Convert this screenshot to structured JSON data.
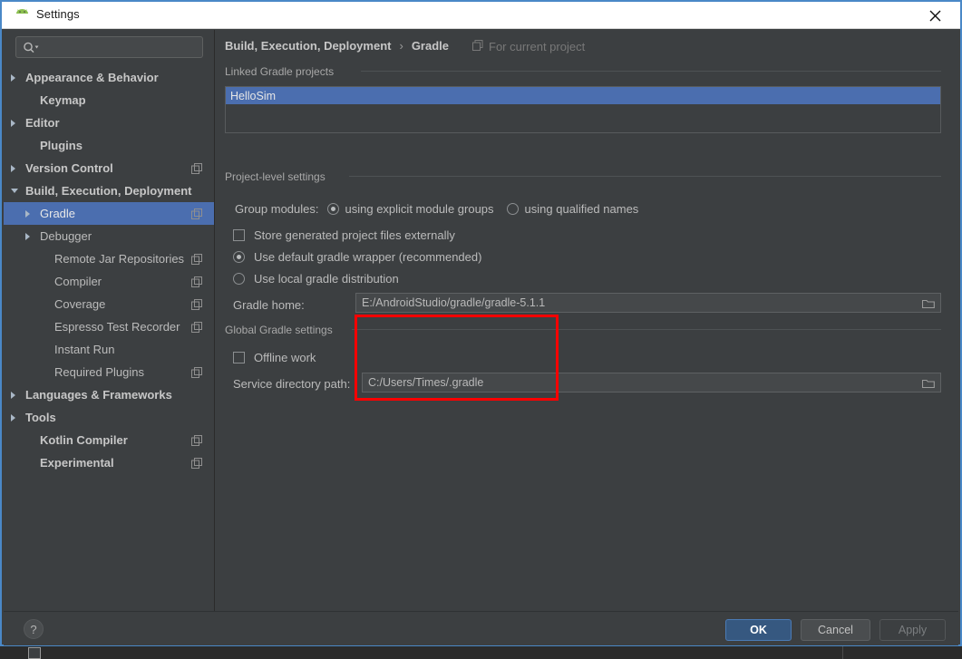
{
  "window": {
    "title": "Settings",
    "app_icon": "android-icon",
    "close_icon": "close-icon"
  },
  "sidebar": {
    "search": {
      "placeholder": "",
      "value": "",
      "icon": "search-icon"
    },
    "items": [
      {
        "label": "Appearance & Behavior",
        "arrow": "collapsed",
        "indent": 24,
        "bold": true,
        "copy": false,
        "selected": false
      },
      {
        "label": "Keymap",
        "arrow": "none",
        "indent": 40,
        "bold": true,
        "copy": false,
        "selected": false
      },
      {
        "label": "Editor",
        "arrow": "collapsed",
        "indent": 24,
        "bold": true,
        "copy": false,
        "selected": false
      },
      {
        "label": "Plugins",
        "arrow": "none",
        "indent": 40,
        "bold": true,
        "copy": false,
        "selected": false
      },
      {
        "label": "Version Control",
        "arrow": "collapsed",
        "indent": 24,
        "bold": true,
        "copy": true,
        "selected": false
      },
      {
        "label": "Build, Execution, Deployment",
        "arrow": "open",
        "indent": 24,
        "bold": true,
        "copy": false,
        "selected": false
      },
      {
        "label": "Gradle",
        "arrow": "collapsed",
        "indent": 40,
        "bold": false,
        "copy": true,
        "selected": true
      },
      {
        "label": "Debugger",
        "arrow": "collapsed",
        "indent": 40,
        "bold": false,
        "copy": false,
        "selected": false
      },
      {
        "label": "Remote Jar Repositories",
        "arrow": "none",
        "indent": 56,
        "bold": false,
        "copy": true,
        "selected": false
      },
      {
        "label": "Compiler",
        "arrow": "none",
        "indent": 56,
        "bold": false,
        "copy": true,
        "selected": false
      },
      {
        "label": "Coverage",
        "arrow": "none",
        "indent": 56,
        "bold": false,
        "copy": true,
        "selected": false
      },
      {
        "label": "Espresso Test Recorder",
        "arrow": "none",
        "indent": 56,
        "bold": false,
        "copy": true,
        "selected": false
      },
      {
        "label": "Instant Run",
        "arrow": "none",
        "indent": 56,
        "bold": false,
        "copy": false,
        "selected": false
      },
      {
        "label": "Required Plugins",
        "arrow": "none",
        "indent": 56,
        "bold": false,
        "copy": true,
        "selected": false
      },
      {
        "label": "Languages & Frameworks",
        "arrow": "collapsed",
        "indent": 24,
        "bold": true,
        "copy": false,
        "selected": false
      },
      {
        "label": "Tools",
        "arrow": "collapsed",
        "indent": 24,
        "bold": true,
        "copy": false,
        "selected": false
      },
      {
        "label": "Kotlin Compiler",
        "arrow": "none",
        "indent": 40,
        "bold": true,
        "copy": true,
        "selected": false
      },
      {
        "label": "Experimental",
        "arrow": "none",
        "indent": 40,
        "bold": true,
        "copy": true,
        "selected": false
      }
    ]
  },
  "main": {
    "breadcrumb": {
      "parent": "Build, Execution, Deployment",
      "separator": "›",
      "leaf": "Gradle"
    },
    "scope": {
      "label": "For current project",
      "icon": "project-scope-icon"
    },
    "linked_projects": {
      "group_title": "Linked Gradle projects",
      "items": [
        {
          "label": "HelloSim",
          "selected": true
        }
      ]
    },
    "project_level": {
      "group_title": "Project-level settings",
      "group_modules_label": "Group modules:",
      "group_modules_options": [
        {
          "label": "using explicit module groups",
          "checked": true
        },
        {
          "label": "using qualified names",
          "checked": false
        }
      ],
      "store_externally": {
        "label": "Store generated project files externally",
        "checked": false
      },
      "distribution_options": [
        {
          "label": "Use default gradle wrapper (recommended)",
          "checked": true
        },
        {
          "label": "Use local gradle distribution",
          "checked": false
        }
      ],
      "gradle_home_label": "Gradle home:",
      "gradle_home_value": "E:/AndroidStudio/gradle/gradle-5.1.1",
      "browse_icon": "folder-browse-icon"
    },
    "global_settings": {
      "group_title": "Global Gradle settings",
      "offline_work": {
        "label": "Offline work",
        "checked": false
      },
      "service_dir_label": "Service directory path:",
      "service_dir_value": "C:/Users/Times/.gradle",
      "browse_icon": "folder-browse-icon"
    },
    "annotation": {
      "color": "#fe0000",
      "name": "service-directory-highlight"
    }
  },
  "footer": {
    "help_label": "?",
    "ok_label": "OK",
    "cancel_label": "Cancel",
    "apply_label": "Apply"
  },
  "colors": {
    "background": "#3c3f41",
    "selection": "#4b6eaf",
    "accent_border": "#4a88c7",
    "primary_button": "#365880",
    "annotation": "#fe0000"
  }
}
